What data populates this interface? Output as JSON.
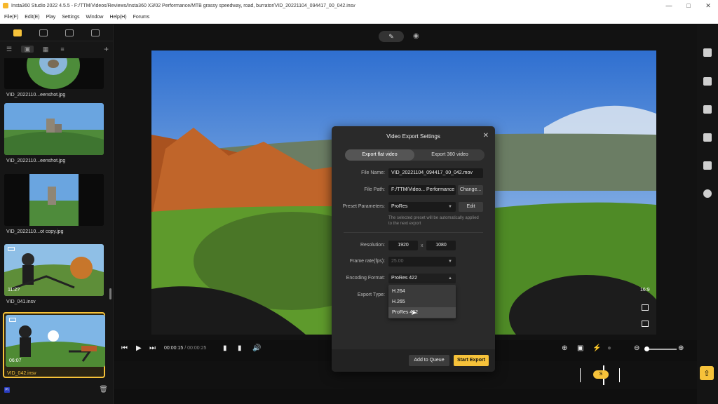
{
  "window": {
    "title": "Insta360 Studio 2022 4.5.5 - F:/TTM/Videos/Reviews/Insta360 X3/02 Performance/MTB grassy speedway, road, burrator/VID_20221104_094417_00_042.insv"
  },
  "menu": [
    "File(F)",
    "Edit(E)",
    "Play",
    "Settings",
    "Window",
    "Help(H)",
    "Forums"
  ],
  "library": {
    "items": [
      {
        "name": "VID_2022110...eenshot.jpg"
      },
      {
        "name": "VID_2022110...eenshot.jpg"
      },
      {
        "name": "VID_2022110...ot copy.jpg"
      },
      {
        "name": "VID_041.insv",
        "duration": "11:2?"
      },
      {
        "name": "VID_042.insv",
        "duration": "06:07",
        "selected": true
      }
    ]
  },
  "preview": {
    "aspect_ratio": "16:9"
  },
  "playback": {
    "current_time": "00:00:15",
    "separator": "/",
    "total_time": "00:00:25"
  },
  "timeline": {
    "marker": "S"
  },
  "dialog": {
    "title": "Video Export Settings",
    "tabs": [
      "Export flat video",
      "Export 360 video"
    ],
    "active_tab": "Export flat video",
    "file_name_label": "File Name:",
    "file_name_value": "VID_20221104_094417_00_042.mov",
    "file_path_label": "File Path:",
    "file_path_value": "F:/TTM/Video... Performance",
    "change_button": "Change...",
    "preset_label": "Preset Parameters:",
    "preset_value": "ProRes",
    "edit_button": "Edit",
    "preset_note": "The selected preset will be automatically applied to the next export",
    "resolution_label": "Resolution:",
    "resolution_width": "1920",
    "resolution_x": "x",
    "resolution_height": "1080",
    "frame_rate_label": "Frame rate(fps):",
    "frame_rate_value": "25.00",
    "encoding_label": "Encoding Format:",
    "encoding_value": "ProRes 422",
    "export_type_label": "Export Type:",
    "encoding_options": [
      "H.264",
      "H.265",
      "ProRes 422"
    ],
    "hovered_option": "ProRes 422",
    "add_to_queue": "Add to Queue",
    "start_export": "Start Export"
  },
  "colors": {
    "accent": "#f6c23a"
  }
}
